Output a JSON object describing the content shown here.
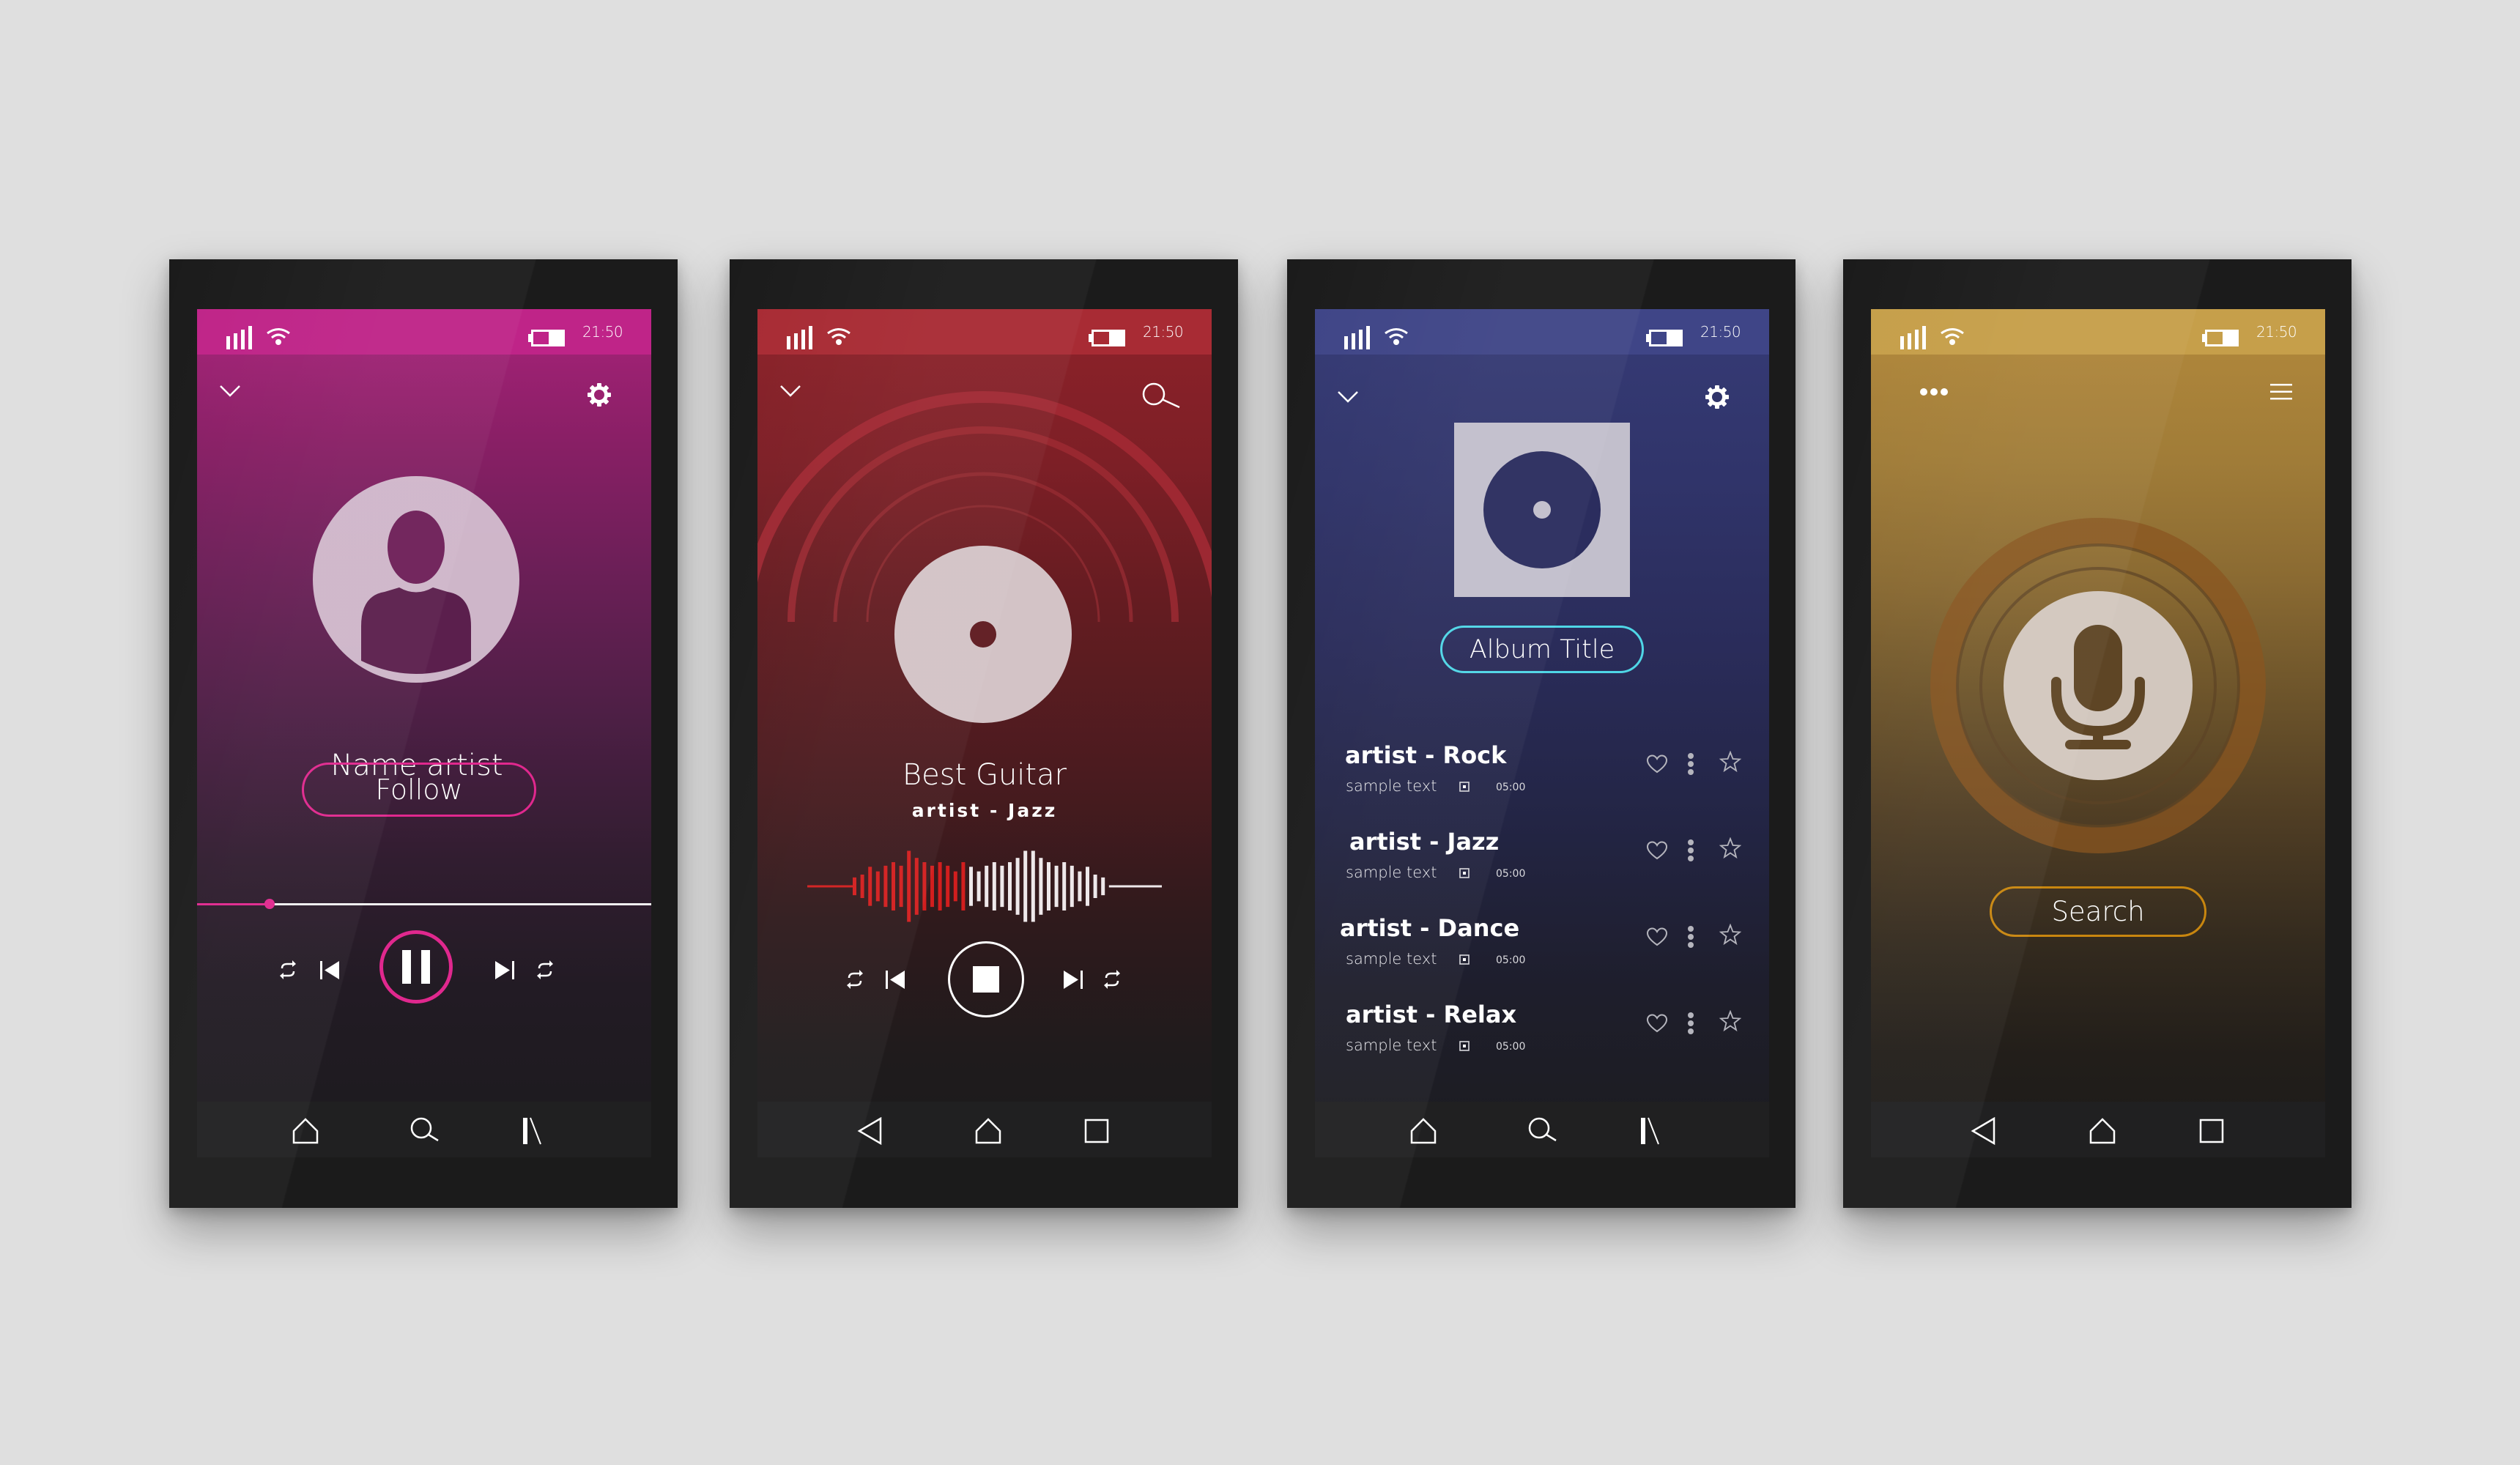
{
  "colors": {
    "background": "#dfdfdf",
    "phone_frame": "#1b1b1b",
    "magenta_accent": "#e0288e",
    "red_accent": "#d21e1e",
    "cyan_accent": "#4fd6e6",
    "gold_accent": "#c8860f"
  },
  "status_bar": {
    "time": "21:50",
    "signal_icon": "signal-bars-icon",
    "wifi_icon": "wifi-icon",
    "battery_icon": "battery-icon"
  },
  "phones": [
    {
      "screen": "artist-profile",
      "theme_color": "#bf2488",
      "header": {
        "left_icon": "chevron-down-icon",
        "right_icon": "gear-icon"
      },
      "avatar_icon": "user-avatar-icon",
      "artist_name": "Name artist",
      "follow_button": "Follow",
      "playback": {
        "progress_fraction": 0.16,
        "controls": [
          "repeat-icon",
          "previous-icon",
          "pause-icon",
          "next-icon",
          "repeat-icon"
        ],
        "state": "playing"
      },
      "nav": [
        "home-icon",
        "search-icon",
        "library-icon"
      ]
    },
    {
      "screen": "now-playing",
      "theme_color": "#a82b34",
      "header": {
        "left_icon": "chevron-down-icon",
        "right_icon": "search-icon"
      },
      "disc_icon": "vinyl-disc-icon",
      "track_title": "Best Guitar",
      "track_artist": "artist - Jazz",
      "waveform": {
        "progress_fraction": 0.45,
        "played_bars": [
          0.25,
          0.33,
          0.55,
          0.42,
          0.58,
          0.68,
          0.58,
          1.0,
          0.8,
          0.68,
          0.58,
          0.68,
          0.58,
          0.42,
          0.68
        ],
        "remaining_bars": [
          0.55,
          0.42,
          0.58,
          0.68,
          0.58,
          0.68,
          0.8,
          1.0,
          1.0,
          0.8,
          0.68,
          0.58,
          0.68,
          0.58,
          0.42,
          0.55,
          0.33,
          0.25
        ]
      },
      "controls": [
        "repeat-icon",
        "previous-icon",
        "stop-icon",
        "next-icon",
        "repeat-icon"
      ],
      "nav": [
        "back-icon",
        "home-icon",
        "recents-icon"
      ]
    },
    {
      "screen": "album",
      "theme_color": "#3f4587",
      "header": {
        "left_icon": "chevron-down-icon",
        "right_icon": "gear-icon"
      },
      "album_art_icon": "album-disc-icon",
      "album_title": "Album Title",
      "tracks": [
        {
          "title": "artist - Rock",
          "subtitle": "sample text",
          "duration": "05:00"
        },
        {
          "title": "artist - Jazz",
          "subtitle": "sample text",
          "duration": "05:00"
        },
        {
          "title": "artist - Dance",
          "subtitle": "sample text",
          "duration": "05:00"
        },
        {
          "title": "artist - Relax",
          "subtitle": "sample text",
          "duration": "05:00"
        }
      ],
      "track_actions": [
        "heart-icon",
        "more-vertical-icon",
        "star-icon"
      ],
      "nav": [
        "home-icon",
        "search-icon",
        "library-icon"
      ]
    },
    {
      "screen": "voice-search",
      "theme_color": "#c69f4a",
      "header": {
        "left_icon": "more-horizontal-icon",
        "right_icon": "hamburger-menu-icon"
      },
      "mic_icon": "microphone-icon",
      "search_button": "Search",
      "nav": [
        "back-icon",
        "home-icon",
        "recents-icon"
      ]
    }
  ]
}
